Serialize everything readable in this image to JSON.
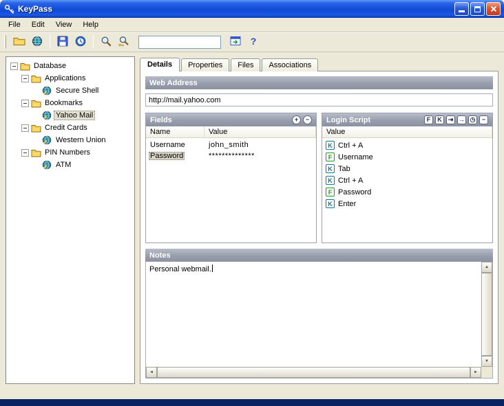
{
  "window": {
    "title": "KeyPass"
  },
  "titlebar": {
    "buttons": [
      {
        "name": "minimize"
      },
      {
        "name": "maximize"
      },
      {
        "name": "close"
      }
    ]
  },
  "menu": {
    "items": [
      "File",
      "Edit",
      "View",
      "Help"
    ]
  },
  "toolbar": {
    "items": [
      {
        "kind": "button",
        "icon": "open-folder"
      },
      {
        "kind": "button",
        "icon": "globe"
      },
      {
        "kind": "separator"
      },
      {
        "kind": "button",
        "icon": "save"
      },
      {
        "kind": "button",
        "icon": "clock"
      },
      {
        "kind": "separator"
      },
      {
        "kind": "button",
        "icon": "search"
      },
      {
        "kind": "button",
        "icon": "search-key"
      },
      {
        "kind": "input",
        "value": ""
      },
      {
        "kind": "button",
        "icon": "window-run"
      },
      {
        "kind": "button",
        "icon": "help"
      }
    ]
  },
  "tree": {
    "items": [
      {
        "label": "Database",
        "level": 0,
        "type": "folder",
        "expandable": true,
        "selected": false
      },
      {
        "label": "Applications",
        "level": 1,
        "type": "folder",
        "expandable": true,
        "selected": false
      },
      {
        "label": "Secure Shell",
        "level": 2,
        "type": "entry",
        "expandable": false,
        "selected": false
      },
      {
        "label": "Bookmarks",
        "level": 1,
        "type": "folder",
        "expandable": true,
        "selected": false
      },
      {
        "label": "Yahoo Mail",
        "level": 2,
        "type": "entry",
        "expandable": false,
        "selected": true
      },
      {
        "label": "Credit Cards",
        "level": 1,
        "type": "folder",
        "expandable": true,
        "selected": false
      },
      {
        "label": "Western Union",
        "level": 2,
        "type": "entry",
        "expandable": false,
        "selected": false
      },
      {
        "label": "PIN Numbers",
        "level": 1,
        "type": "folder",
        "expandable": true,
        "selected": false
      },
      {
        "label": "ATM",
        "level": 2,
        "type": "entry",
        "expandable": false,
        "selected": false
      }
    ]
  },
  "tabs": [
    {
      "label": "Details",
      "active": true
    },
    {
      "label": "Properties",
      "active": false
    },
    {
      "label": "Files",
      "active": false
    },
    {
      "label": "Associations",
      "active": false
    }
  ],
  "details": {
    "web_address": {
      "label": "Web Address",
      "value": "http://mail.yahoo.com"
    },
    "fields": {
      "title": "Fields",
      "buttons": [
        {
          "name": "add-field",
          "glyph": "+"
        },
        {
          "name": "remove-field",
          "glyph": "−"
        }
      ],
      "columns": [
        "Name",
        "Value"
      ],
      "rows": [
        {
          "name": "Username",
          "value": "john_smith",
          "selected": false
        },
        {
          "name": "Password",
          "value": "**************",
          "selected": true
        }
      ]
    },
    "login_script": {
      "title": "Login Script",
      "buttons": [
        {
          "name": "insert-field",
          "glyph": "F"
        },
        {
          "name": "insert-keystroke",
          "glyph": "K"
        },
        {
          "name": "insert-tab",
          "glyph": "⇥"
        },
        {
          "name": "insert-arrow",
          "glyph": "→"
        },
        {
          "name": "insert-delay",
          "glyph": "◷"
        },
        {
          "name": "remove-step",
          "glyph": "−"
        }
      ],
      "column": "Value",
      "items": [
        {
          "icon": "K",
          "label": "Ctrl + A"
        },
        {
          "icon": "F",
          "label": "Username"
        },
        {
          "icon": "K",
          "label": "Tab"
        },
        {
          "icon": "K",
          "label": "Ctrl + A"
        },
        {
          "icon": "F",
          "label": "Password"
        },
        {
          "icon": "K",
          "label": "Enter"
        }
      ]
    },
    "notes": {
      "title": "Notes",
      "text": "Personal webmail."
    }
  }
}
